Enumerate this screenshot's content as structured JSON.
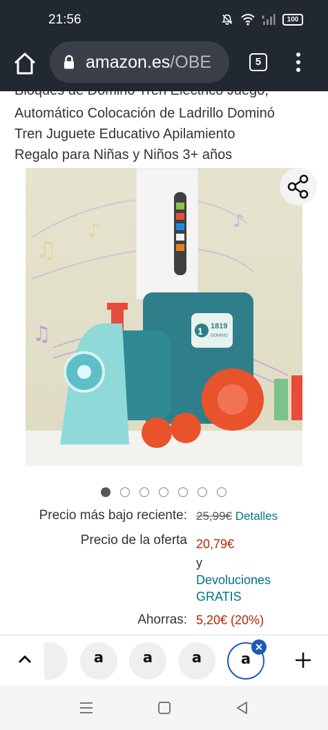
{
  "status_bar": {
    "time": "21:56",
    "battery": "100"
  },
  "browser": {
    "url_domain": "amazon.es",
    "url_path": "/OBE",
    "tab_count": "5"
  },
  "product": {
    "title_cut": "Bloques de Dominó Tren Eléctrico Juego,",
    "title_lines": [
      "Automático Colocación de Ladrillo Dominó",
      "Tren Juguete Educativo Apilamiento",
      "Regalo para Niñas y Niños 3+ años"
    ],
    "image_badge": {
      "number": "1",
      "model": "1819",
      "brand": "DOMINO"
    },
    "image_count": 7,
    "active_image": 1
  },
  "pricing": {
    "recent_low_label": "Precio más bajo reciente:",
    "recent_low_value": "25,99€",
    "details_link": "Detalles",
    "offer_label": "Precio de la oferta",
    "offer_value": "20,79€",
    "and_text": "y",
    "returns_line1": "Devoluciones",
    "returns_line2": "GRATIS",
    "savings_label": "Ahorras:",
    "savings_value": "5,20€ (20%)"
  },
  "tab_strip": {
    "tab_glyph": "a",
    "tabs": [
      "a",
      "a",
      "a",
      "a"
    ],
    "close_symbol": "✕"
  },
  "colors": {
    "toolbar": "#222831",
    "link": "#007185",
    "price_red": "#b12704",
    "active_tab_ring": "#1a5bb5"
  }
}
